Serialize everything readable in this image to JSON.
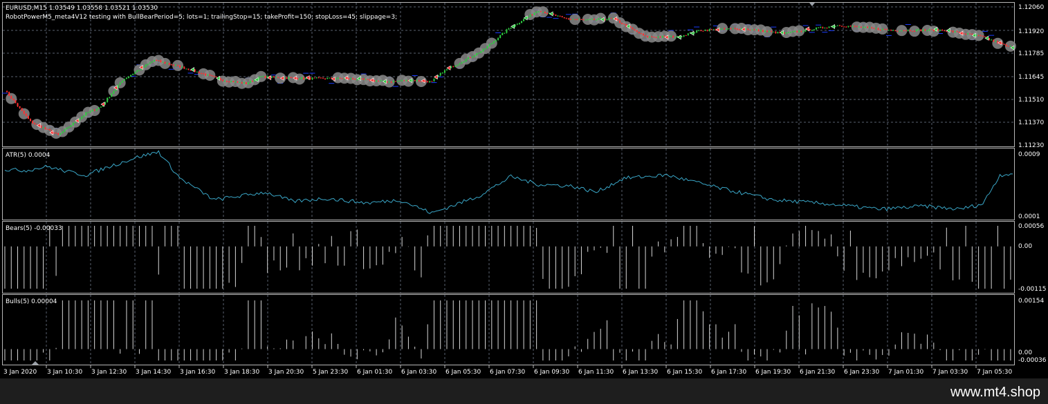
{
  "colors": {
    "background": "#000000",
    "grid": "#5a6270",
    "candle_up": "#2ecc40",
    "candle_down": "#ff3030",
    "atr_line": "#3aa7c8",
    "histogram": "#d8d8d8",
    "marker_halo": "#8a8a8a",
    "sl_tp": "#1a3cff",
    "footer": "#1e1e1e"
  },
  "main": {
    "title_line": "EURUSD,M15  1.03549 1.03558 1.03521 1.03530",
    "expert_line": "RobotPowerM5_meta4V12 testing with BullBearPeriod=5; lots=1; trailingStop=15; takeProfit=150; stopLoss=45; slippage=3;",
    "price_labels": [
      "1.12060",
      "1.11920",
      "1.11785",
      "1.11645",
      "1.11510",
      "1.11370",
      "1.11230"
    ]
  },
  "atr": {
    "label": "ATR(5) 0.0004",
    "scale_labels": [
      "0.0009",
      "0.0001"
    ]
  },
  "bears": {
    "label": "Bears(5) -0.00033",
    "scale_labels": [
      "0.00056",
      "0.00",
      "-0.00115"
    ]
  },
  "bulls": {
    "label": "Bulls(5) 0.00004",
    "scale_labels": [
      "0.00154",
      "0.00",
      "-0.00036"
    ]
  },
  "time_labels": [
    "3 Jan 2020",
    "3 Jan 10:30",
    "3 Jan 12:30",
    "3 Jan 14:30",
    "3 Jan 16:30",
    "3 Jan 18:30",
    "3 Jan 20:30",
    "5 Jan 23:30",
    "6 Jan 01:30",
    "6 Jan 03:30",
    "6 Jan 05:30",
    "6 Jan 07:30",
    "6 Jan 09:30",
    "6 Jan 11:30",
    "6 Jan 13:30",
    "6 Jan 15:30",
    "6 Jan 17:30",
    "6 Jan 19:30",
    "6 Jan 21:30",
    "6 Jan 23:30",
    "7 Jan 01:30",
    "7 Jan 03:30",
    "7 Jan 05:30"
  ],
  "footer": {
    "brand": "www.mt4.shop"
  },
  "chart_data": {
    "type": "line",
    "title": "EURUSD,M15  1.03549 1.03558 1.03521 1.03530",
    "price_range": [
      1.1123,
      1.1206
    ],
    "price_anchors": [
      [
        0,
        1.1156
      ],
      [
        12,
        1.1137
      ],
      [
        25,
        1.1129
      ],
      [
        38,
        1.1142
      ],
      [
        45,
        1.1146
      ],
      [
        55,
        1.1162
      ],
      [
        70,
        1.1174
      ],
      [
        85,
        1.1169
      ],
      [
        102,
        1.1162
      ],
      [
        113,
        1.116
      ],
      [
        120,
        1.1164
      ],
      [
        140,
        1.1163
      ],
      [
        160,
        1.1163
      ],
      [
        180,
        1.1161
      ],
      [
        190,
        1.1162
      ],
      [
        200,
        1.1161
      ],
      [
        205,
        1.1167
      ],
      [
        224,
        1.118
      ],
      [
        236,
        1.1193
      ],
      [
        250,
        1.1204
      ],
      [
        262,
        1.1199
      ],
      [
        272,
        1.1198
      ],
      [
        285,
        1.1199
      ],
      [
        300,
        1.1188
      ],
      [
        315,
        1.1188
      ],
      [
        326,
        1.1192
      ],
      [
        345,
        1.1193
      ],
      [
        365,
        1.119
      ],
      [
        390,
        1.1195
      ],
      [
        415,
        1.1192
      ],
      [
        440,
        1.1192
      ],
      [
        458,
        1.1188
      ],
      [
        470,
        1.1182
      ]
    ],
    "atr": {
      "name": "ATR(5)",
      "range": [
        0.0001,
        0.0009
      ],
      "anchors": [
        [
          0,
          0.00069
        ],
        [
          10,
          0.00068
        ],
        [
          20,
          0.00073
        ],
        [
          30,
          0.00066
        ],
        [
          38,
          0.00062
        ],
        [
          48,
          0.00072
        ],
        [
          62,
          0.00085
        ],
        [
          72,
          0.00092
        ],
        [
          82,
          0.00058
        ],
        [
          98,
          0.0003
        ],
        [
          110,
          0.00035
        ],
        [
          122,
          0.0004
        ],
        [
          135,
          0.00028
        ],
        [
          150,
          0.00032
        ],
        [
          170,
          0.00026
        ],
        [
          185,
          0.0003
        ],
        [
          200,
          0.00013
        ],
        [
          222,
          0.00035
        ],
        [
          237,
          0.0006
        ],
        [
          250,
          0.0005
        ],
        [
          265,
          0.00048
        ],
        [
          277,
          0.0004
        ],
        [
          290,
          0.00058
        ],
        [
          310,
          0.00062
        ],
        [
          335,
          0.00045
        ],
        [
          360,
          0.0003
        ],
        [
          385,
          0.00025
        ],
        [
          410,
          0.00018
        ],
        [
          430,
          0.00022
        ],
        [
          447,
          0.00018
        ],
        [
          458,
          0.00025
        ],
        [
          466,
          0.00062
        ],
        [
          472,
          0.00064
        ]
      ]
    },
    "bears": {
      "name": "Bears(5)",
      "range": [
        -0.00115,
        0.00056
      ]
    },
    "bulls": {
      "name": "Bulls(5)",
      "range": [
        -0.00036,
        0.00154
      ]
    }
  }
}
